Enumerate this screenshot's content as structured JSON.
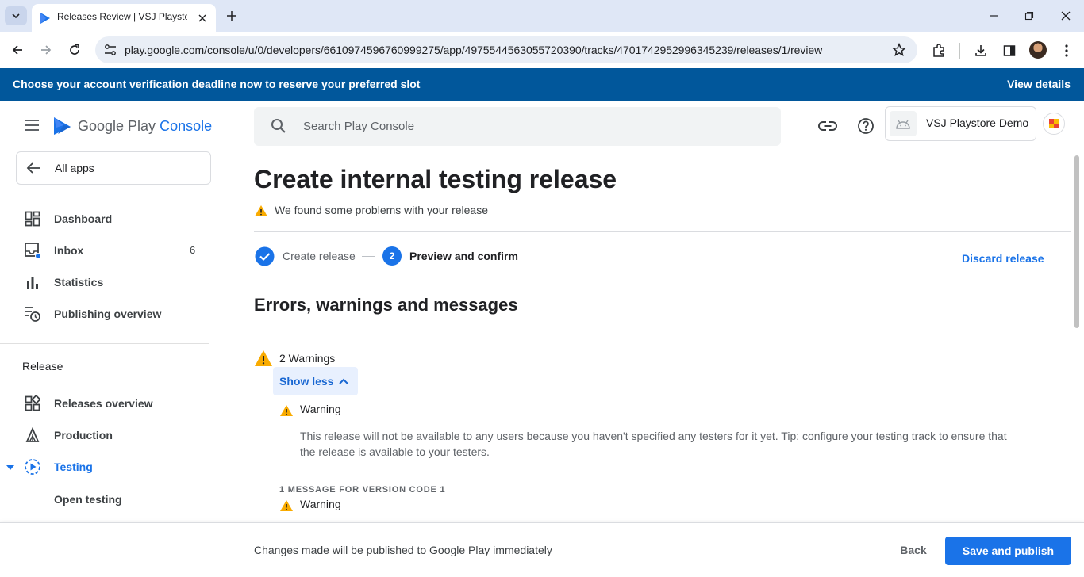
{
  "browser": {
    "tab_title": "Releases Review | VSJ Playstore",
    "url": "play.google.com/console/u/0/developers/6610974596760999275/app/4975544563055720390/tracks/4701742952996345239/releases/1/review"
  },
  "banner": {
    "text": "Choose your account verification deadline now to reserve your preferred slot",
    "link": "View details"
  },
  "brand": {
    "google_play": "Google Play",
    "console": "Console"
  },
  "sidebar": {
    "all_apps": "All apps",
    "items": [
      {
        "label": "Dashboard",
        "icon": "dashboard-icon"
      },
      {
        "label": "Inbox",
        "icon": "inbox-icon",
        "count": "6"
      },
      {
        "label": "Statistics",
        "icon": "bar-chart-icon"
      },
      {
        "label": "Publishing overview",
        "icon": "publishing-overview-icon"
      }
    ],
    "section": "Release",
    "release_items": [
      {
        "label": "Releases overview",
        "icon": "releases-overview-icon"
      },
      {
        "label": "Production",
        "icon": "production-icon"
      },
      {
        "label": "Testing",
        "icon": "testing-icon",
        "active": true
      }
    ],
    "sub_item": "Open testing"
  },
  "header": {
    "search_placeholder": "Search Play Console",
    "app_name": "VSJ Playstore Demo"
  },
  "main": {
    "title": "Create internal testing release",
    "problem_text": "We found some problems with your release",
    "steps": [
      {
        "label": "Create release",
        "state": "done"
      },
      {
        "number": "2",
        "label": "Preview and confirm",
        "state": "current"
      }
    ],
    "discard": "Discard release",
    "section_title": "Errors, warnings and messages",
    "warning_count": "2 Warnings",
    "show_less": "Show less",
    "warnings": [
      {
        "label": "Warning",
        "description": "This release will not be available to any users because you haven't specified any testers for it yet. Tip: configure your testing track to ensure that the release is available to your testers."
      }
    ],
    "message_group": "1 MESSAGE FOR VERSION CODE 1",
    "message_warning": "Warning"
  },
  "footer": {
    "text": "Changes made will be published to Google Play immediately",
    "back": "Back",
    "publish": "Save and publish"
  },
  "colors": {
    "accent": "#1a73e8",
    "banner": "#01579b",
    "warning": "#f9ab00"
  }
}
